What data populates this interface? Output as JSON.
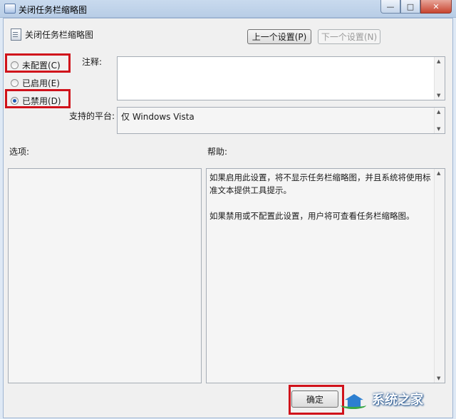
{
  "window": {
    "title": "关闭任务栏缩略图",
    "min_glyph": "—",
    "max_glyph": "□",
    "close_glyph": "✕"
  },
  "header": {
    "policy_name": "关闭任务栏缩略图",
    "prev_button": "上一个设置(P)",
    "next_button": "下一个设置(N)"
  },
  "state": {
    "options": [
      {
        "label": "未配置(C)",
        "checked": false
      },
      {
        "label": "已启用(E)",
        "checked": false
      },
      {
        "label": "已禁用(D)",
        "checked": true
      }
    ]
  },
  "comment": {
    "label": "注释:",
    "value": ""
  },
  "supported": {
    "label": "支持的平台:",
    "value": "仅 Windows Vista"
  },
  "options_section": {
    "label": "选项:"
  },
  "help_section": {
    "label": "帮助:",
    "paragraphs": [
      "如果启用此设置，将不显示任务栏缩略图，并且系统将使用标准文本提供工具提示。",
      "如果禁用或不配置此设置，用户将可查看任务栏缩略图。"
    ]
  },
  "footer": {
    "ok_button": "确定"
  },
  "watermark": {
    "text": "系统之家"
  },
  "colors": {
    "highlight": "#d0121b",
    "radio_checked": "#1f5bb4"
  }
}
